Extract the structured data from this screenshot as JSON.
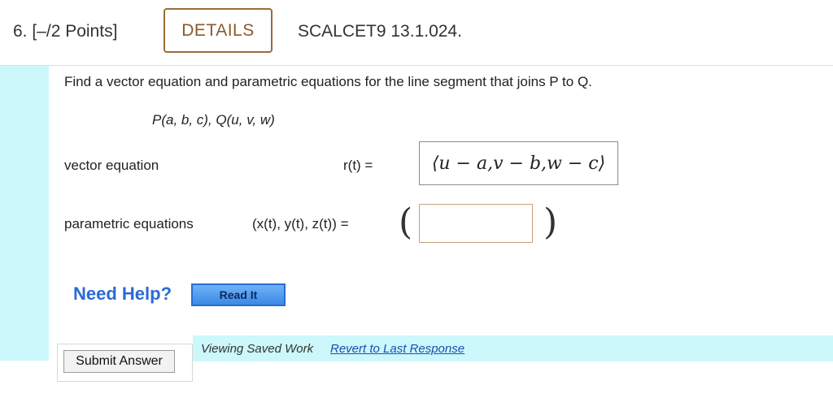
{
  "header": {
    "question_label": "6.  [–/2 Points]",
    "details_label": "DETAILS",
    "course_code": "SCALCET9 13.1.024."
  },
  "problem": {
    "prompt": "Find a vector equation and parametric equations for the line segment that joins P to Q.",
    "points": "P(a, b, c),    Q(u, v, w)"
  },
  "vector_equation": {
    "label": "vector equation",
    "lhs": "r(t)  =",
    "answer": "⟨u − a,v − b,w − c⟩"
  },
  "parametric_equations": {
    "label": "parametric equations",
    "lhs": "(x(t), y(t), z(t))  =",
    "left_paren": "(",
    "right_paren": ")",
    "value": ""
  },
  "help": {
    "need_help": "Need Help?",
    "read_it": "Read It"
  },
  "status": {
    "viewing_text": "Viewing Saved Work",
    "revert_link": "Revert to Last Response"
  },
  "actions": {
    "submit_label": "Submit Answer"
  }
}
